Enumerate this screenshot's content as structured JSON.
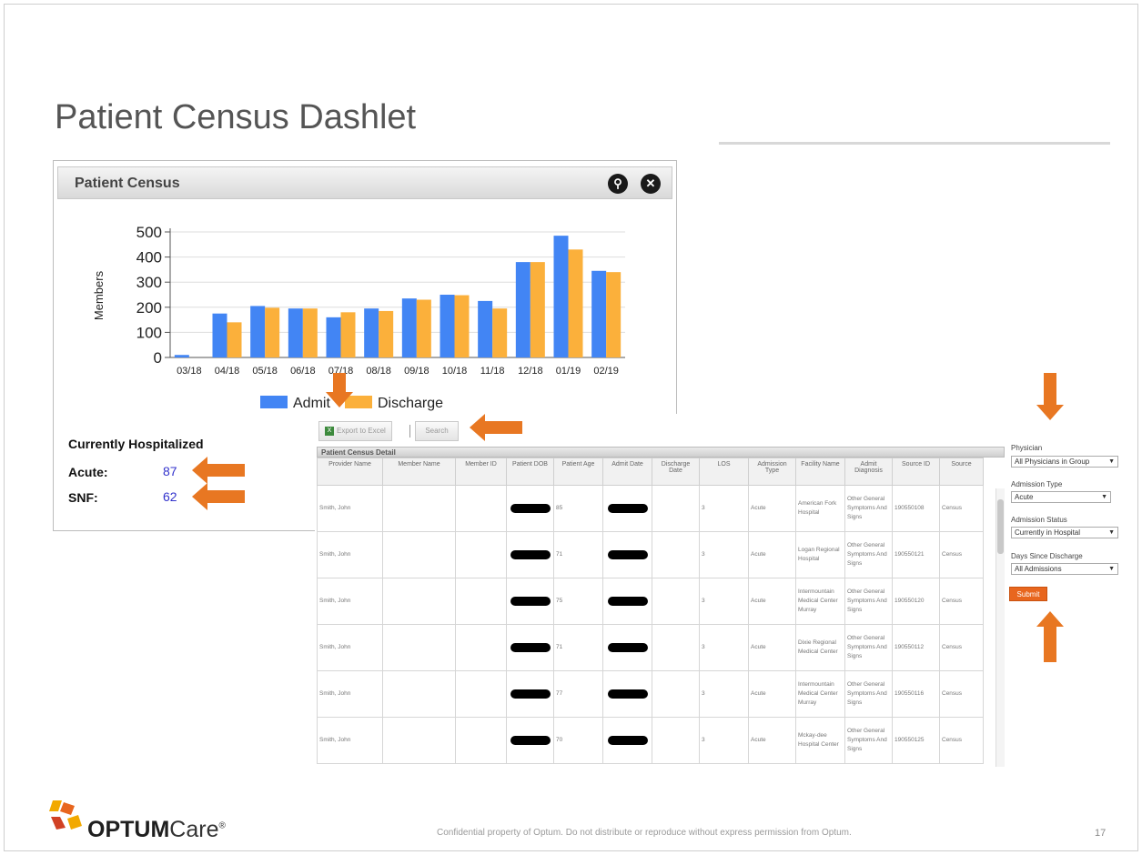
{
  "slide": {
    "title": "Patient Census Dashlet",
    "footer_note": "Confidential property of Optum. Do not distribute or reproduce without express permission from Optum.",
    "page_number": "17",
    "logo_brand": "OPTUM",
    "logo_suffix": "Care",
    "logo_mark": "®"
  },
  "dashlet": {
    "title": "Patient Census",
    "search_icon": "search-icon",
    "close_icon": "close-icon",
    "hospitalized_title": "Currently Hospitalized",
    "acute_label": "Acute:",
    "acute_value": "87",
    "snf_label": "SNF:",
    "snf_value": "62"
  },
  "chart_data": {
    "type": "bar",
    "title": "",
    "xlabel": "",
    "ylabel": "Members",
    "ylim": [
      0,
      500
    ],
    "yticks": [
      "0",
      "100",
      "200",
      "300",
      "400",
      "500"
    ],
    "grid": true,
    "legend_position": "bottom",
    "categories": [
      "03/18",
      "04/18",
      "05/18",
      "06/18",
      "07/18",
      "08/18",
      "09/18",
      "10/18",
      "11/18",
      "12/18",
      "01/19",
      "02/19"
    ],
    "series": [
      {
        "name": "Admit",
        "color": "#4285f4",
        "values": [
          10,
          175,
          205,
          195,
          160,
          195,
          235,
          250,
          225,
          380,
          485,
          345
        ]
      },
      {
        "name": "Discharge",
        "color": "#fbb03b",
        "values": [
          0,
          140,
          198,
          195,
          180,
          185,
          230,
          248,
          195,
          380,
          430,
          340
        ]
      }
    ]
  },
  "detail": {
    "export_label": "Export to Excel",
    "search_label": "Search",
    "grid_title": "Patient Census Detail",
    "columns": [
      "Provider Name",
      "Member Name",
      "Member ID",
      "Patient DOB",
      "Patient Age",
      "Admit Date",
      "Discharge Date",
      "LOS",
      "Admission Type",
      "Facility Name",
      "Admit Diagnosis",
      "Source ID",
      "Source"
    ],
    "rows": [
      {
        "provider": "Smith, John",
        "age": "85",
        "los": "3",
        "type": "Acute",
        "facility": "American Fork Hospital",
        "diagnosis": "Other General Symptoms And Signs",
        "source_id": "190550108",
        "source": "Census"
      },
      {
        "provider": "Smith, John",
        "age": "71",
        "los": "3",
        "type": "Acute",
        "facility": "Logan Regional Hospital",
        "diagnosis": "Other General Symptoms And Signs",
        "source_id": "190550121",
        "source": "Census"
      },
      {
        "provider": "Smith, John",
        "age": "75",
        "los": "3",
        "type": "Acute",
        "facility": "Intermountain Medical Center Murray",
        "diagnosis": "Other General Symptoms And Signs",
        "source_id": "190550120",
        "source": "Census"
      },
      {
        "provider": "Smith, John",
        "age": "71",
        "los": "3",
        "type": "Acute",
        "facility": "Dixie Regional Medical Center",
        "diagnosis": "Other General Symptoms And Signs",
        "source_id": "190550112",
        "source": "Census"
      },
      {
        "provider": "Smith, John",
        "age": "77",
        "los": "3",
        "type": "Acute",
        "facility": "Intermountain Medical Center Murray",
        "diagnosis": "Other General Symptoms And Signs",
        "source_id": "190550116",
        "source": "Census"
      },
      {
        "provider": "Smith, John",
        "age": "70",
        "los": "3",
        "type": "Acute",
        "facility": "Mckay-dee Hospital Center",
        "diagnosis": "Other General Symptoms And Signs",
        "source_id": "190550125",
        "source": "Census"
      }
    ]
  },
  "filters": {
    "physician_label": "Physician",
    "physician_value": "All Physicians in Group",
    "admission_type_label": "Admission Type",
    "admission_type_value": "Acute",
    "admission_status_label": "Admission Status",
    "admission_status_value": "Currently in Hospital",
    "days_since_label": "Days Since Discharge",
    "days_since_value": "All Admissions",
    "submit_label": "Submit"
  },
  "colors": {
    "accent_orange": "#e87722",
    "admit_blue": "#4285f4",
    "discharge_gold": "#fbb03b"
  }
}
